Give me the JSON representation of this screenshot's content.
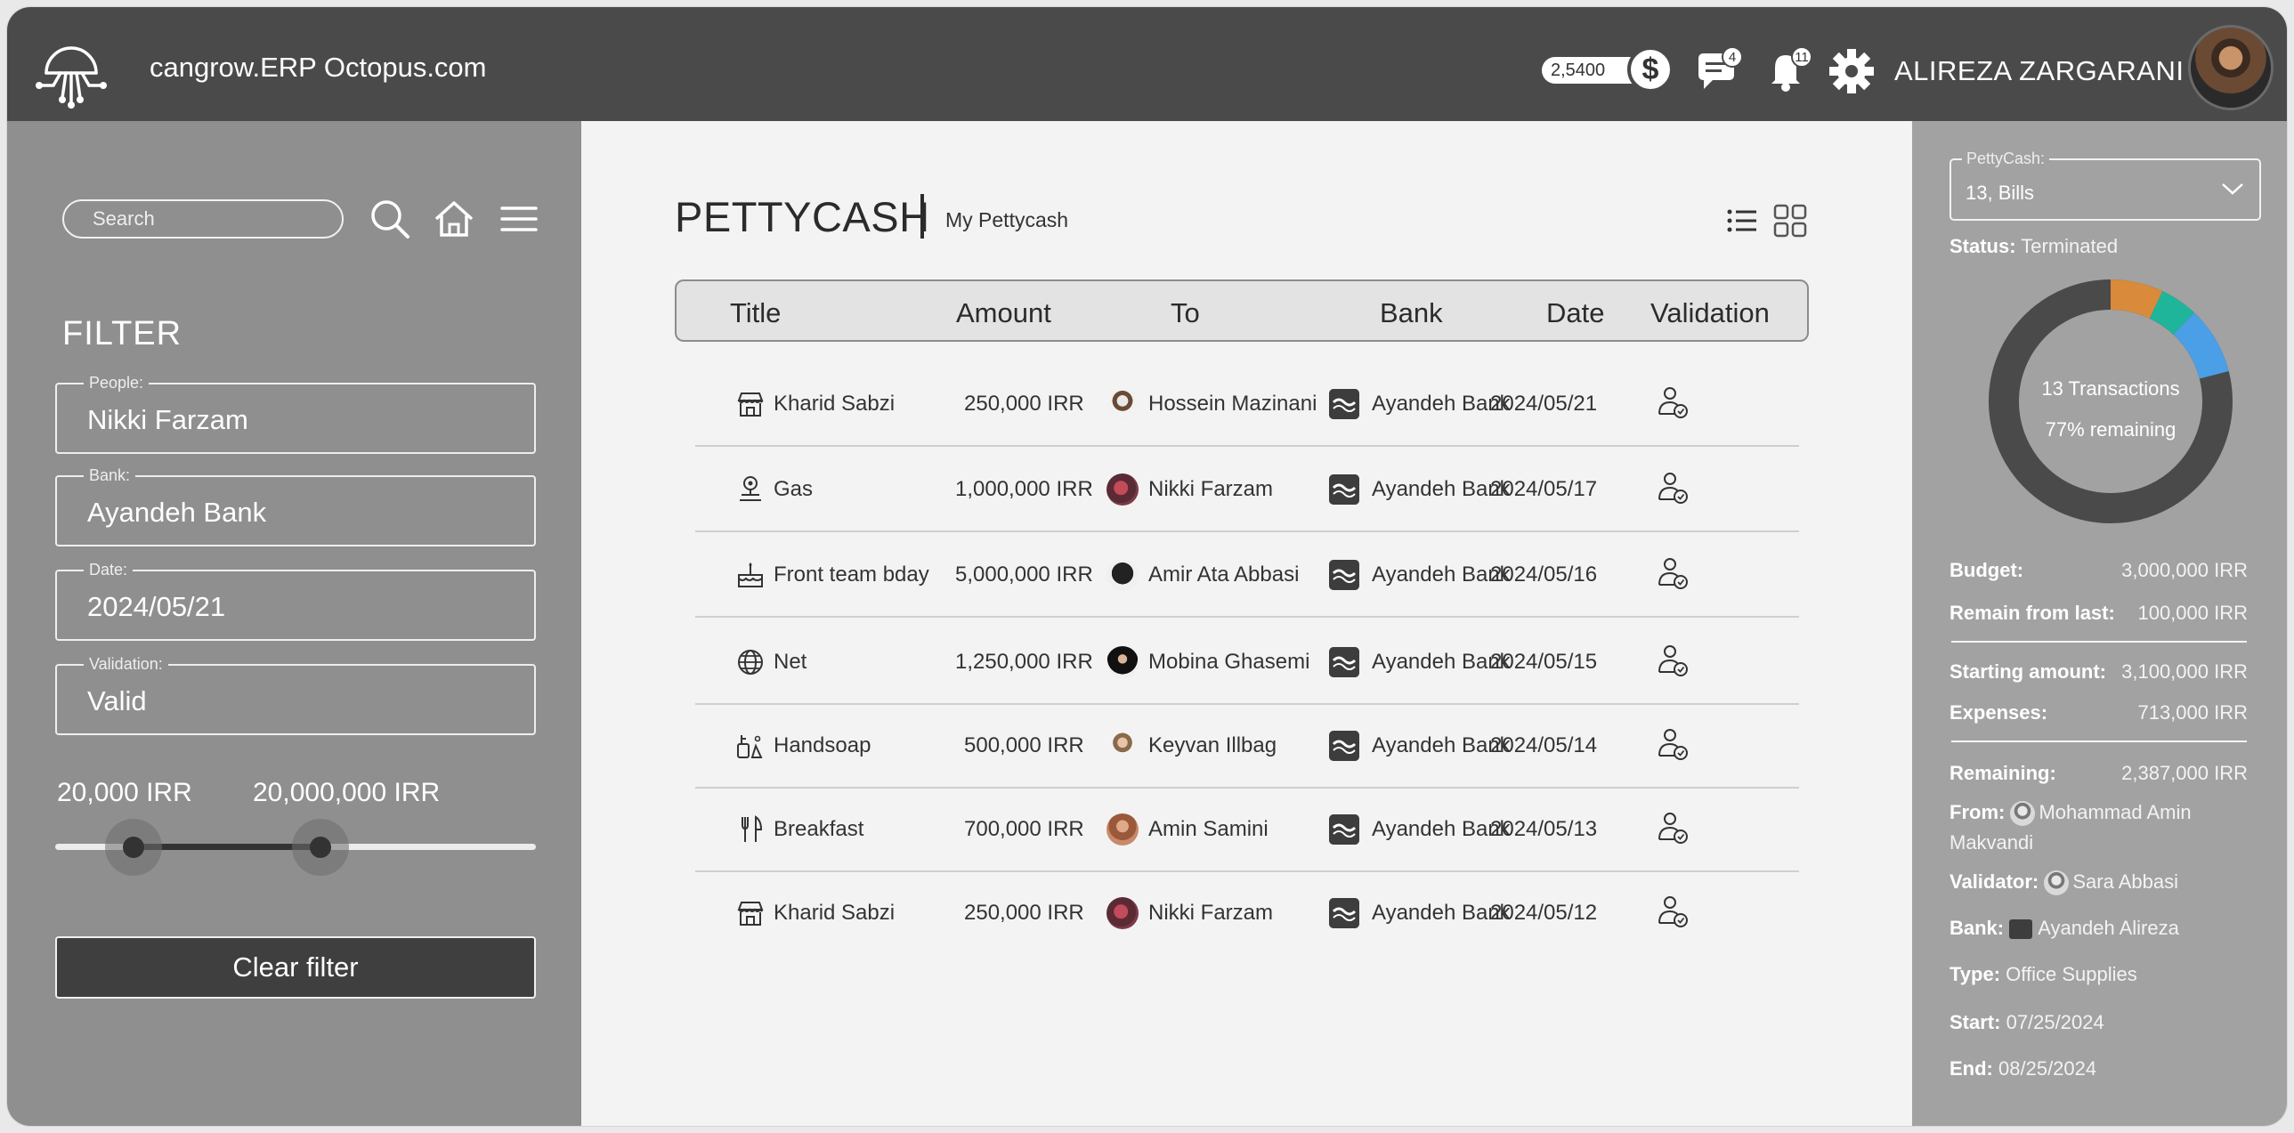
{
  "header": {
    "brand": "cangrow.ERP Octopus.com",
    "balance": "2,5400",
    "currency_symbol": "$",
    "messages_count": "4",
    "notifications_count": "11",
    "user_name": "ALIREZA ZARGARANI"
  },
  "sidebar": {
    "search_placeholder": "Search",
    "filter_title": "FILTER",
    "fields": [
      {
        "label": "People:",
        "value": "Nikki Farzam"
      },
      {
        "label": "Bank:",
        "value": "Ayandeh Bank"
      },
      {
        "label": "Date:",
        "value": "2024/05/21"
      },
      {
        "label": "Validation:",
        "value": "Valid"
      }
    ],
    "range_min": "20,000 IRR",
    "range_max": "20,000,000 IRR",
    "clear_label": "Clear filter"
  },
  "main": {
    "title": "PETTYCASH",
    "subtitle": "My Pettycash",
    "columns": [
      "Title",
      "Amount",
      "To",
      "Bank",
      "Date",
      "Validation"
    ],
    "rows": [
      {
        "title": "Kharid Sabzi",
        "icon": "store-icon",
        "amount": "250,000 IRR",
        "to": "Hossein Mazinani",
        "bank": "Ayandeh Bank",
        "date": "2024/05/21"
      },
      {
        "title": "Gas",
        "icon": "gas-icon",
        "amount": "1,000,000 IRR",
        "to": "Nikki Farzam",
        "bank": "Ayandeh Bank",
        "date": "2024/05/17"
      },
      {
        "title": "Front team bday",
        "icon": "cake-icon",
        "amount": "5,000,000 IRR",
        "to": "Amir Ata Abbasi",
        "bank": "Ayandeh Bank",
        "date": "2024/05/16"
      },
      {
        "title": "Net",
        "icon": "globe-icon",
        "amount": "1,250,000 IRR",
        "to": "Mobina Ghasemi",
        "bank": "Ayandeh Bank",
        "date": "2024/05/15"
      },
      {
        "title": "Handsoap",
        "icon": "soap-icon",
        "amount": "500,000 IRR",
        "to": "Keyvan Illbag",
        "bank": "Ayandeh Bank",
        "date": "2024/05/14"
      },
      {
        "title": "Breakfast",
        "icon": "cutlery-icon",
        "amount": "700,000 IRR",
        "to": "Amin Samini",
        "bank": "Ayandeh Bank",
        "date": "2024/05/13"
      },
      {
        "title": "Kharid Sabzi",
        "icon": "store-icon",
        "amount": "250,000 IRR",
        "to": "Nikki Farzam",
        "bank": "Ayandeh Bank",
        "date": "2024/05/12"
      }
    ]
  },
  "detail": {
    "select_label": "PettyCash:",
    "select_value": "13, Bills",
    "status_label": "Status:",
    "status_value": "Terminated",
    "donut_line1": "13 Transactions",
    "donut_line2": "77% remaining",
    "donut_segments": [
      {
        "color": "#d98a3a",
        "fraction": 0.07
      },
      {
        "color": "#1fb59a",
        "fraction": 0.05
      },
      {
        "color": "#4a9fe6",
        "fraction": 0.09
      },
      {
        "color": "#4a4a4a",
        "fraction": 0.79
      }
    ],
    "budget_label": "Budget:",
    "budget_value": "3,000,000 IRR",
    "remain_label": "Remain from last:",
    "remain_value": "100,000 IRR",
    "starting_label": "Starting amount:",
    "starting_value": "3,100,000 IRR",
    "expenses_label": "Expenses:",
    "expenses_value": "713,000 IRR",
    "remaining_label": "Remaining:",
    "remaining_value": "2,387,000 IRR",
    "from_label": "From:",
    "from_value": "Mohammad Amin Makvandi",
    "validator_label": "Validator:",
    "validator_value": "Sara Abbasi",
    "bank_label": "Bank:",
    "bank_value": "Ayandeh Alireza",
    "type_label": "Type:",
    "type_value": "Office Supplies",
    "start_label": "Start:",
    "start_value": "07/25/2024",
    "end_label": "End:",
    "end_value": "08/25/2024"
  }
}
